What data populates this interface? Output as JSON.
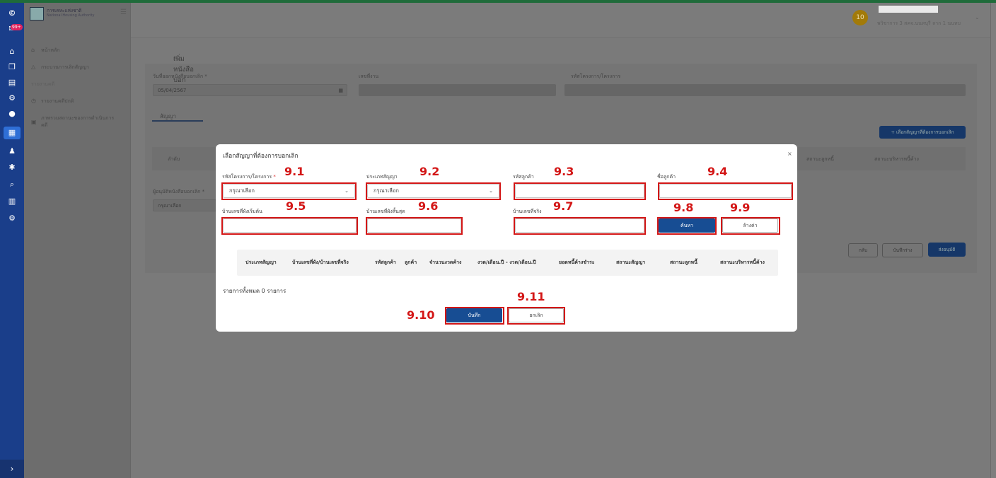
{
  "app": {
    "org_name_th": "การเคหะแห่งชาติ",
    "org_name_en": "National Housing Authority",
    "notification_count": "99+"
  },
  "sidebar": {
    "items": [
      {
        "label": "หน้าหลัก",
        "icon": "home-icon"
      },
      {
        "label": "กระบวนการเลิกสัญญา",
        "icon": "warning-icon"
      },
      {
        "label": "รายงานคดี",
        "icon": ""
      },
      {
        "label": "รายงานคดีปกติ",
        "icon": "clock-icon"
      },
      {
        "label": "ภาพรวมสถานะของการดำเนินการคดี",
        "icon": "document-icon"
      }
    ]
  },
  "user": {
    "avatar": "10",
    "role": "พวิชาการ 3 สคจ.นนทบุรี ลาก 1 นนทบ"
  },
  "page": {
    "back_title": "เพิ่มหนังสือบอกเลิก",
    "date_label": "วันที่ออกหนังสือบอกเลิก *",
    "date_value": "05/04/2567",
    "doc_no_label": "เลขที่งาน",
    "project_label": "รหัสโครงการ/โครงการ",
    "tab_contract": "สัญญา",
    "add_contract_button": "+ เลือกสัญญาที่ต้องการบอกเลิก",
    "bg_table_headers": [
      "ลำดับ",
      "สถานะลูกหนี้",
      "สถานะบริหารหนี้ค้าง"
    ],
    "approver_label": "ผู้อนุมัติหนังสือบอกเลิก *",
    "approver_value": "กรุณาเลือก",
    "back_button": "กลับ",
    "draft_button": "บันทึกร่าง",
    "submit_button": "ส่งอนุมัติ"
  },
  "modal": {
    "title": "เลือกสัญญาที่ต้องการบอกเลิก",
    "close": "×",
    "fields": {
      "project_label": "รหัสโครงการ/โครงการ",
      "project_required": "*",
      "project_value": "กรุณาเลือก",
      "contract_type_label": "ประเภทสัญญา",
      "contract_type_value": "กรุณาเลือก",
      "customer_code_label": "รหัสลูกค้า",
      "customer_name_label": "ชื่อลูกค้า",
      "house_start_label": "บ้านเลขที่ผังเริ่มต้น",
      "house_end_label": "บ้านเลขที่ผังสิ้นสุด",
      "house_actual_label": "บ้านเลขที่จริง"
    },
    "search_button": "ค้นหา",
    "clear_button": "ล้างค่า",
    "table_headers": [
      "ประเภทสัญญา",
      "บ้านเลขที่ผัง/บ้านเลขที่จริง",
      "รหัสลูกค้า",
      "ลูกค้า",
      "จำนวนงวดค้าง",
      "งวด/เดือน.ปี - งวด/เดือน.ปี",
      "ยอดหนี้ค้างชำระ",
      "สถานะสัญญา",
      "สถานะลูกหนี้",
      "สถานะบริหารหนี้ค้าง"
    ],
    "total_text": "รายการทั้งหมด 0 รายการ",
    "save_button": "บันทึก",
    "cancel_button": "ยกเลิก"
  },
  "annotations": [
    "9.1",
    "9.2",
    "9.3",
    "9.4",
    "9.5",
    "9.6",
    "9.7",
    "9.8",
    "9.9",
    "9.10",
    "9.11"
  ],
  "colors": {
    "highlight": "#d31616",
    "primary": "#174d93",
    "rail": "#1a3e8a"
  }
}
